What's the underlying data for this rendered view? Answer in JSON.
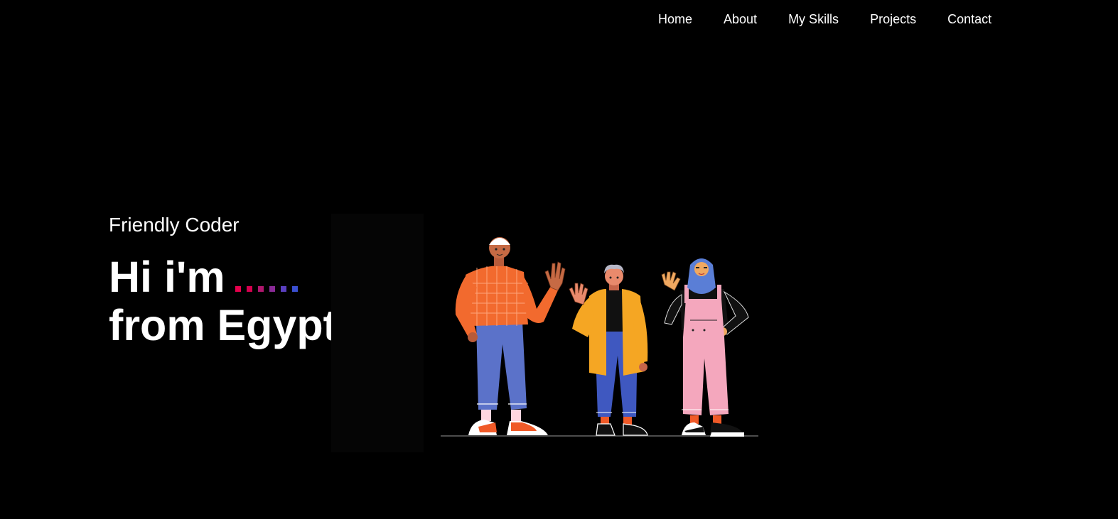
{
  "nav": {
    "items": [
      {
        "label": "Home"
      },
      {
        "label": "About"
      },
      {
        "label": "My Skills"
      },
      {
        "label": "Projects"
      },
      {
        "label": "Contact"
      }
    ]
  },
  "hero": {
    "subtitle": "Friendly Coder",
    "headline_line1": "Hi i'm",
    "headline_line2": "from Egypt",
    "dot_colors": [
      "#e6004c",
      "#d6004f",
      "#b0176e",
      "#8a2a96",
      "#5a3fbf",
      "#3a4fd0"
    ]
  },
  "illustration": {
    "icon": "waving-people-illustration"
  },
  "colors": {
    "background": "#000000",
    "text": "#ffffff"
  }
}
